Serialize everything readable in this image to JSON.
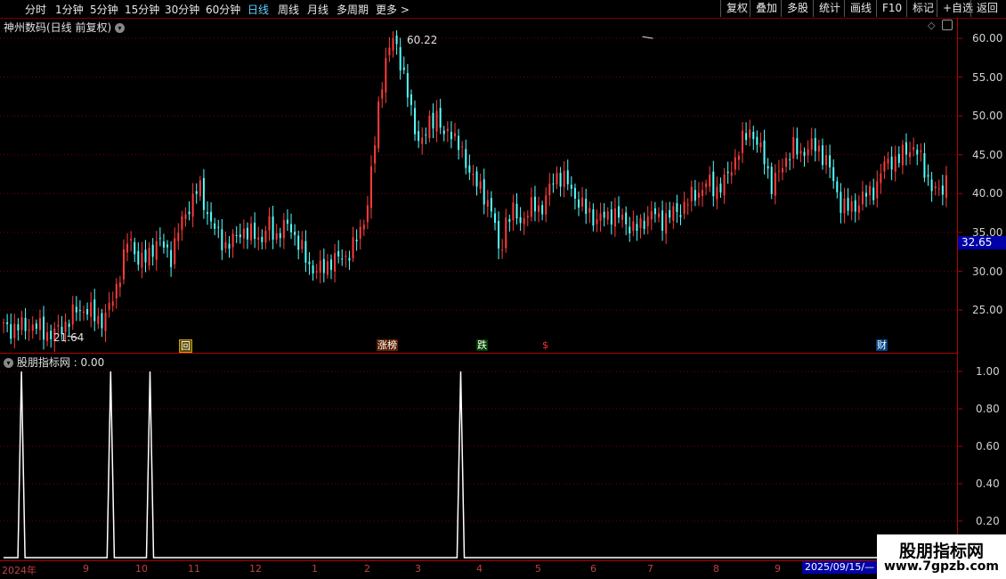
{
  "toolbar": {
    "periods": [
      "分时",
      "1分钟",
      "5分钟",
      "15分钟",
      "30分钟",
      "60分钟",
      "日线",
      "周线",
      "月线",
      "多周期",
      "更多"
    ],
    "active_period": "日线",
    "more_arrow": ">",
    "actions": [
      "复权",
      "叠加",
      "多股",
      "统计",
      "画线",
      "F10",
      "标记",
      "+自选",
      "返回"
    ]
  },
  "main_chart": {
    "title": "神州数码(日线 前复权)",
    "y_ticks": [
      "60.00",
      "55.00",
      "50.00",
      "45.00",
      "40.00",
      "35.00",
      "30.00",
      "25.00"
    ],
    "high_label": "60.22",
    "low_label": "21.64",
    "current_price": "32.65",
    "markers": [
      "回",
      "涨榜",
      "跌",
      "$",
      "财"
    ]
  },
  "indicator": {
    "title": "股朋指标网 : 0.00",
    "y_ticks": [
      "1.00",
      "0.80",
      "0.60",
      "0.40",
      "0.20"
    ]
  },
  "x_axis": {
    "labels": [
      "2024年",
      "9",
      "10",
      "11",
      "12",
      "1",
      "2",
      "3",
      "4",
      "5",
      "6",
      "7",
      "8",
      "9"
    ],
    "date_box": "2025/09/15/—"
  },
  "watermark": {
    "name": "股朋指标网",
    "url": "www.7gpzb.com"
  },
  "colors": {
    "up": "#ff3c3c",
    "down": "#54ffff",
    "axis": "#b00000",
    "grid": "#7a0000",
    "active": "#5fd0ff"
  },
  "chart_data": [
    {
      "type": "candlestick",
      "title": "神州数码(日线 前复权)",
      "y_range": [
        20,
        62
      ],
      "y_ticks": [
        25,
        30,
        35,
        40,
        45,
        50,
        55,
        60
      ],
      "close_path": [
        22.8,
        22.5,
        23.0,
        22.6,
        23.2,
        22.7,
        22.0,
        21.9,
        22.4,
        23.4,
        24.5,
        25.2,
        25.0,
        24.2,
        23.6,
        24.8,
        27.5,
        31.0,
        34.5,
        32.0,
        31.0,
        32.5,
        34.0,
        33.0,
        32.0,
        35.0,
        37.5,
        39.0,
        41.0,
        38.0,
        35.5,
        34.5,
        33.0,
        34.0,
        35.5,
        34.5,
        35.0,
        34.0,
        36.0,
        34.5,
        35.5,
        36.0,
        34.0,
        32.0,
        30.5,
        30.0,
        30.5,
        31.5,
        31.5,
        32.0,
        33.0,
        35.0,
        38.0,
        45.0,
        54.0,
        58.0,
        60.2,
        56.5,
        52.0,
        48.0,
        46.5,
        49.0,
        50.5,
        47.0,
        48.5,
        46.5,
        44.0,
        43.0,
        40.5,
        39.5,
        38.0,
        31.5,
        37.0,
        37.5,
        36.5,
        37.5,
        38.5,
        38.0,
        40.0,
        42.5,
        42.0,
        41.0,
        39.5,
        38.0,
        37.5,
        36.5,
        37.0,
        37.5,
        37.0,
        36.5,
        35.5,
        35.5,
        37.0,
        37.5,
        36.5,
        37.0,
        37.5,
        38.0,
        39.0,
        40.0,
        40.5,
        41.5,
        40.5,
        41.0,
        43.0,
        45.0,
        47.0,
        48.5,
        46.0,
        44.5,
        41.0,
        42.5,
        44.5,
        46.0,
        45.0,
        46.0,
        46.0,
        45.5,
        44.0,
        41.0,
        38.5,
        38.0,
        38.5,
        39.5,
        40.0,
        41.0,
        43.5,
        44.5,
        44.0,
        45.5,
        46.0,
        45.0,
        43.0,
        40.5,
        40.0,
        42.0
      ],
      "high": 60.22,
      "low": 21.64,
      "current_price": 32.65,
      "markers": [
        "回",
        "涨榜",
        "跌",
        "$",
        "财"
      ]
    },
    {
      "type": "line",
      "title": "股朋指标网",
      "y_range": [
        0,
        1
      ],
      "y_ticks": [
        0.2,
        0.4,
        0.6,
        0.8,
        1.0
      ],
      "series": [
        {
          "values": [
            0,
            0,
            0,
            0,
            0,
            1,
            0,
            0,
            0,
            0,
            0,
            0,
            0,
            0,
            0,
            0,
            0,
            0,
            0,
            0,
            0,
            0,
            0,
            0,
            0,
            0,
            0,
            0,
            0,
            0,
            1,
            0,
            0,
            0,
            0,
            0,
            0,
            0,
            0,
            0,
            0,
            1,
            0,
            0,
            0,
            0,
            0,
            0,
            0,
            0,
            0,
            0,
            0,
            0,
            0,
            0,
            0,
            0,
            0,
            0,
            0,
            0,
            0,
            0,
            0,
            0,
            0,
            0,
            0,
            0,
            0,
            0,
            0,
            0,
            0,
            0,
            0,
            0,
            0,
            0,
            0,
            0,
            0,
            0,
            0,
            0,
            0,
            0,
            0,
            0,
            0,
            0,
            0,
            0,
            0,
            0,
            0,
            0,
            0,
            0,
            0,
            0,
            0,
            0,
            0,
            0,
            0,
            0,
            0,
            0,
            0,
            0,
            0,
            0,
            0,
            0,
            0,
            0,
            0,
            0,
            0,
            0,
            0,
            0,
            0,
            0,
            0,
            0,
            1,
            0,
            0,
            0,
            0,
            0,
            0,
            0,
            0,
            0,
            0,
            0,
            0,
            0,
            0,
            0,
            0,
            0,
            0,
            0,
            0,
            0,
            0,
            0,
            0,
            0,
            0,
            0,
            0,
            0,
            0,
            0,
            0,
            0,
            0,
            0,
            0,
            0,
            0,
            0,
            0,
            0,
            0,
            0,
            0,
            0,
            0,
            0,
            0,
            0,
            0,
            0,
            0,
            0,
            0,
            0,
            0,
            0,
            0,
            0,
            0,
            0,
            0,
            0,
            0,
            0,
            0,
            0,
            0,
            0,
            0,
            0,
            0,
            0,
            0,
            0,
            0,
            0,
            0,
            0,
            0,
            0,
            0,
            0,
            0,
            0,
            0,
            0,
            0,
            0,
            0,
            0,
            0,
            0,
            0,
            0,
            0,
            0,
            0,
            0,
            0,
            0,
            0,
            0,
            0,
            0,
            0,
            0,
            0,
            0,
            0,
            0,
            0,
            0,
            0,
            0,
            0,
            0,
            0,
            0,
            0,
            0,
            0,
            0,
            0,
            0,
            0,
            0,
            0,
            0,
            0,
            0,
            0,
            0,
            0,
            0,
            0
          ]
        }
      ],
      "current_value": 0.0
    }
  ]
}
